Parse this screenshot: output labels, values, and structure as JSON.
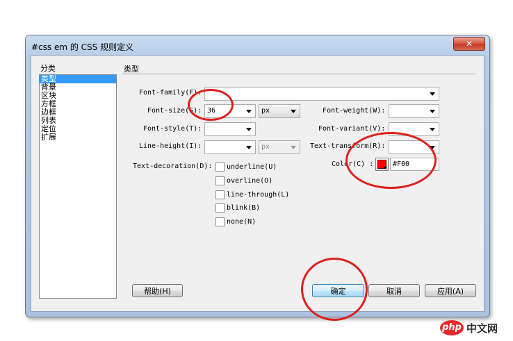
{
  "window": {
    "title": "#css em 的 CSS 规则定义",
    "close_symbol": "✕"
  },
  "category": {
    "label": "分类",
    "items": [
      "类型",
      "背景",
      "区块",
      "方框",
      "边框",
      "列表",
      "定位",
      "扩展"
    ],
    "selected_index": 0
  },
  "section_title": "类型",
  "fields": {
    "font_family": {
      "label": "Font-family(F):",
      "value": ""
    },
    "font_size": {
      "label": "Font-size(S):",
      "value": "36",
      "unit": "px"
    },
    "font_weight": {
      "label": "Font-weight(W):",
      "value": ""
    },
    "font_style": {
      "label": "Font-style(T):",
      "value": ""
    },
    "font_variant": {
      "label": "Font-variant(V):",
      "value": ""
    },
    "line_height": {
      "label": "Line-height(I):",
      "value": "",
      "unit": "px"
    },
    "text_transform": {
      "label": "Text-transform(R):",
      "value": ""
    },
    "color": {
      "label": "Color(C) :",
      "value": "#F00",
      "swatch": "#ff0000"
    },
    "text_decoration": {
      "label": "Text-decoration(D):",
      "options": [
        "underline(U)",
        "overline(O)",
        "line-through(L)",
        "blink(B)",
        "none(N)"
      ]
    }
  },
  "buttons": {
    "help": "帮助(H)",
    "ok": "确定",
    "cancel": "取消",
    "apply": "应用(A)"
  },
  "watermark": {
    "logo": "php",
    "text": "中文网"
  },
  "colors": {
    "annotation_red": "#e01e1e",
    "selection": "#3399ff"
  }
}
